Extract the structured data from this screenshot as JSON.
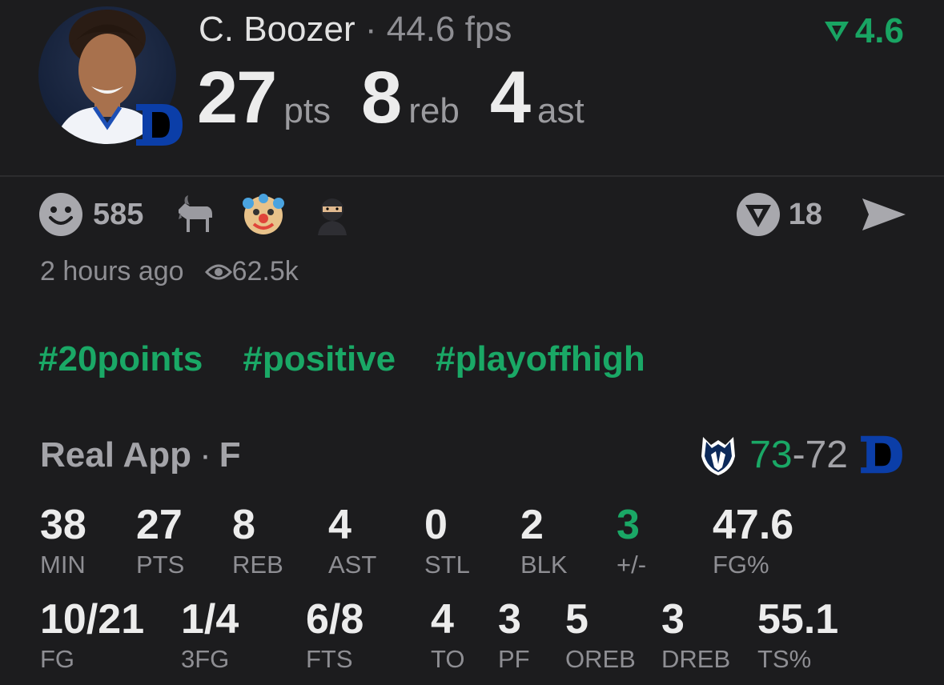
{
  "player": {
    "name": "C. Boozer",
    "separator": "·",
    "fps": "44.6 fps",
    "rating": "4.6",
    "stats": [
      {
        "value": "27",
        "unit": "pts"
      },
      {
        "value": "8",
        "unit": "reb"
      },
      {
        "value": "4",
        "unit": "ast"
      }
    ]
  },
  "reactions": {
    "count": "585",
    "comments": "18"
  },
  "meta": {
    "time": "2 hours ago",
    "views": "62.5k"
  },
  "hashtags": [
    "#20points",
    "#positive",
    "#playoffhigh"
  ],
  "game": {
    "app": "Real App",
    "separator": "·",
    "status": "F",
    "score_win": "73",
    "score_dash": "-",
    "score_lose": "72"
  },
  "box_row1": [
    {
      "value": "38",
      "label": "MIN"
    },
    {
      "value": "27",
      "label": "PTS"
    },
    {
      "value": "8",
      "label": "REB"
    },
    {
      "value": "4",
      "label": "AST"
    },
    {
      "value": "0",
      "label": "STL"
    },
    {
      "value": "2",
      "label": "BLK"
    },
    {
      "value": "3",
      "label": "+/-"
    },
    {
      "value": "47.6",
      "label": "FG%"
    }
  ],
  "box_row2": [
    {
      "value": "10/21",
      "label": "FG"
    },
    {
      "value": "1/4",
      "label": "3FG"
    },
    {
      "value": "6/8",
      "label": "FTS"
    },
    {
      "value": "4",
      "label": "TO"
    },
    {
      "value": "3",
      "label": "PF"
    },
    {
      "value": "5",
      "label": "OREB"
    },
    {
      "value": "3",
      "label": "DREB"
    },
    {
      "value": "55.1",
      "label": "TS%"
    }
  ],
  "colors": {
    "background": "#1c1c1e",
    "accent_green": "#1aa866",
    "muted": "#8e8e93",
    "duke_blue": "#0b3ea8"
  }
}
